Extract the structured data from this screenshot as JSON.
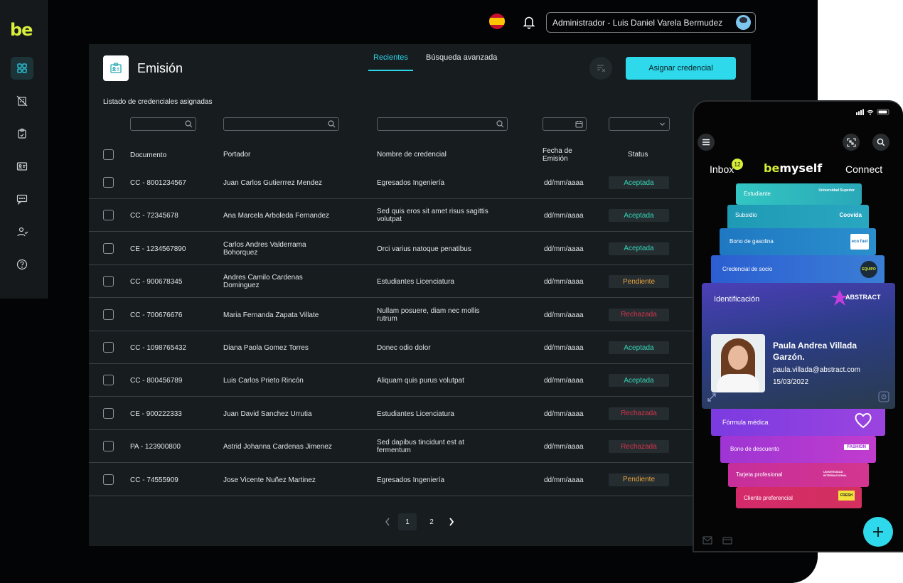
{
  "app": {
    "logo": "be",
    "user_label": "Administrador - Luis Daniel Varela Bermudez"
  },
  "sidebar": {
    "items": [
      {
        "icon": "grid-icon"
      },
      {
        "icon": "building-off-icon"
      },
      {
        "icon": "clipboard-icon"
      },
      {
        "icon": "id-card-icon"
      },
      {
        "icon": "chat-icon"
      },
      {
        "icon": "users-icon"
      },
      {
        "icon": "help-icon"
      }
    ]
  },
  "page": {
    "title": "Emisión",
    "tabs": [
      "Recientes",
      "Búsqueda avanzada"
    ],
    "assign_label": "Asignar credencial",
    "subtitle": "Listado de credenciales asignadas"
  },
  "table": {
    "headers": {
      "documento": "Documento",
      "portador": "Portador",
      "nombre": "Nombre de credencial",
      "fecha_1": "Fecha  de",
      "fecha_2": "Emisión",
      "status": "Status"
    },
    "rows": [
      {
        "doc": "CC - 8001234567",
        "holder": "Juan Carlos Gutierrrez Mendez",
        "holder2": "",
        "cred": "Egresados Ingeniería",
        "cred2": "",
        "date": "dd/mm/aaaa",
        "status": "Aceptada"
      },
      {
        "doc": "CC - 72345678",
        "holder": "Ana Marcela Arboleda Fernandez",
        "holder2": "",
        "cred": "Sed quis eros sit amet risus sagittis",
        "cred2": "volutpat",
        "date": "dd/mm/aaaa",
        "status": "Aceptada"
      },
      {
        "doc": "CE - 1234567890",
        "holder": "Carlos Andres Valderrama",
        "holder2": "Bohorquez",
        "cred": "Orci varius natoque penatibus",
        "cred2": "",
        "date": "dd/mm/aaaa",
        "status": "Aceptada"
      },
      {
        "doc": "CC - 900678345",
        "holder": "Andres Camilo Cardenas",
        "holder2": "Dominguez",
        "cred": "Estudiantes Licenciatura",
        "cred2": "",
        "date": "dd/mm/aaaa",
        "status": "Pendiente"
      },
      {
        "doc": "CC - 700676676",
        "holder": "Maria Fernanda Zapata Villate",
        "holder2": "",
        "cred": "Nullam posuere, diam nec mollis",
        "cred2": "rutrum",
        "date": "dd/mm/aaaa",
        "status": "Rechazada"
      },
      {
        "doc": "CC - 1098765432",
        "holder": "Diana Paola Gomez Torres",
        "holder2": "",
        "cred": "Donec odio dolor",
        "cred2": "",
        "date": "dd/mm/aaaa",
        "status": "Aceptada"
      },
      {
        "doc": "CC - 800456789",
        "holder": "Luis Carlos Prieto Rincón",
        "holder2": "",
        "cred": "Aliquam quis purus volutpat",
        "cred2": "",
        "date": "dd/mm/aaaa",
        "status": "Aceptada"
      },
      {
        "doc": "CE - 900222333",
        "holder": "Juan David Sanchez Urrutia",
        "holder2": "",
        "cred": "Estudiantes Licenciatura",
        "cred2": "",
        "date": "dd/mm/aaaa",
        "status": "Rechazada"
      },
      {
        "doc": "PA - 123900800",
        "holder": "Astrid Johanna Cardenas Jimenez",
        "holder2": "",
        "cred": "Sed dapibus tincidunt est at",
        "cred2": "fermentum",
        "date": "dd/mm/aaaa",
        "status": "Rechazada"
      },
      {
        "doc": "CC - 74555909",
        "holder": "Jose Vicente Nuñez Martinez",
        "holder2": "",
        "cred": "Egresados Ingeniería",
        "cred2": "",
        "date": "dd/mm/aaaa",
        "status": "Pendiente"
      }
    ]
  },
  "pagination": {
    "pages": [
      "1",
      "2"
    ],
    "current": "1"
  },
  "status_colors": {
    "Aceptada": "#34d3b4",
    "Pendiente": "#e6a23c",
    "Rechazada": "#d2344b"
  },
  "phone": {
    "nav_inbox": "Inbox",
    "inbox_count": "12",
    "brand_a": "be",
    "brand_b": "myself",
    "nav_connect": "Connect",
    "cards": [
      {
        "label": "Estudiante",
        "logo": "Universidad Superior"
      },
      {
        "label": "Subsidio",
        "logo": "Coovida"
      },
      {
        "label": "Bono de gasolina",
        "logo": "eco fuel"
      },
      {
        "label": "Credencial de socio",
        "logo": "EQUIPO"
      },
      {
        "label": "Fórmula médica",
        "logo": ""
      },
      {
        "label": "Bono de descuento",
        "logo": "FASHION"
      },
      {
        "label": "Tarjeta profesional",
        "logo": "UNIVERSIDAD INTERNACIONAL"
      },
      {
        "label": "Cliente preferencial",
        "logo": "FRESH"
      }
    ],
    "id_card": {
      "title": "Identificación",
      "brand": "ABSTRACT",
      "name_1": "Paula Andrea Villada",
      "name_2": "Garzón.",
      "email": "paula.villada@abstract.com",
      "date": "15/03/2022"
    }
  }
}
